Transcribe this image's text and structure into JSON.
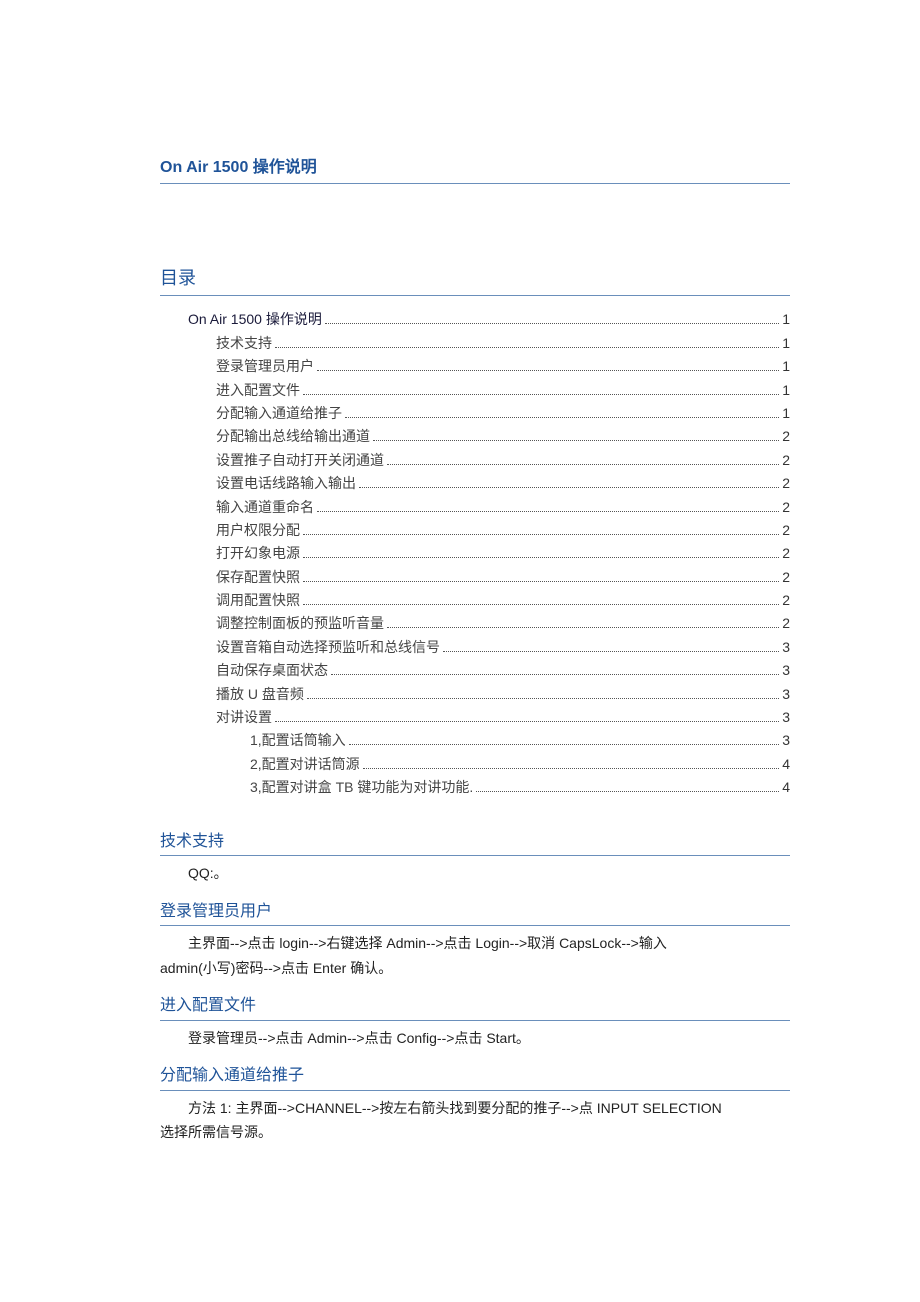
{
  "mainTitle": "On Air 1500  操作说明",
  "tocTitle": "目录",
  "toc": [
    {
      "level": 1,
      "text": "On Air 1500  操作说明 ",
      "page": "1"
    },
    {
      "level": 2,
      "text": "技术支持",
      "page": "1"
    },
    {
      "level": 2,
      "text": "登录管理员用户",
      "page": "1"
    },
    {
      "level": 2,
      "text": "进入配置文件",
      "page": "1"
    },
    {
      "level": 2,
      "text": "分配输入通道给推子",
      "page": "1"
    },
    {
      "level": 2,
      "text": "分配输出总线给输出通道",
      "page": "2"
    },
    {
      "level": 2,
      "text": "设置推子自动打开关闭通道",
      "page": "2"
    },
    {
      "level": 2,
      "text": "设置电话线路输入输出",
      "page": "2"
    },
    {
      "level": 2,
      "text": "输入通道重命名",
      "page": "2"
    },
    {
      "level": 2,
      "text": "用户权限分配",
      "page": "2"
    },
    {
      "level": 2,
      "text": "打开幻象电源",
      "page": "2"
    },
    {
      "level": 2,
      "text": "保存配置快照",
      "page": "2"
    },
    {
      "level": 2,
      "text": "调用配置快照",
      "page": "2"
    },
    {
      "level": 2,
      "text": "调整控制面板的预监听音量",
      "page": "2"
    },
    {
      "level": 2,
      "text": "设置音箱自动选择预监听和总线信号",
      "page": "3"
    },
    {
      "level": 2,
      "text": "自动保存桌面状态",
      "page": "3"
    },
    {
      "level": 2,
      "text": "播放 U 盘音频",
      "page": "3"
    },
    {
      "level": 2,
      "text": "对讲设置",
      "page": "3"
    },
    {
      "level": 3,
      "text": "1,配置话筒输入",
      "page": "3"
    },
    {
      "level": 3,
      "text": "2,配置对讲话筒源",
      "page": "4"
    },
    {
      "level": 3,
      "text": "3,配置对讲盒 TB 键功能为对讲功能.",
      "page": "4"
    }
  ],
  "sections": [
    {
      "title": "技术支持",
      "paragraphs": [
        {
          "cls": "section-body",
          "text": "QQ:。"
        }
      ]
    },
    {
      "title": "登录管理员用户",
      "paragraphs": [
        {
          "cls": "section-body indent",
          "text": "主界面-->点击 login-->右键选择 Admin-->点击 Login-->取消 CapsLock-->输入"
        },
        {
          "cls": "section-body cont",
          "text": "admin(小写)密码-->点击 Enter 确认。"
        }
      ]
    },
    {
      "title": "进入配置文件",
      "paragraphs": [
        {
          "cls": "section-body indent",
          "text": "登录管理员-->点击 Admin-->点击 Config-->点击 Start。"
        }
      ]
    },
    {
      "title": "分配输入通道给推子",
      "paragraphs": [
        {
          "cls": "section-body indent",
          "text": "方法 1:  主界面-->CHANNEL-->按左右箭头找到要分配的推子-->点 INPUT SELECTION"
        },
        {
          "cls": "section-body cont",
          "text": "选择所需信号源。"
        }
      ]
    }
  ]
}
